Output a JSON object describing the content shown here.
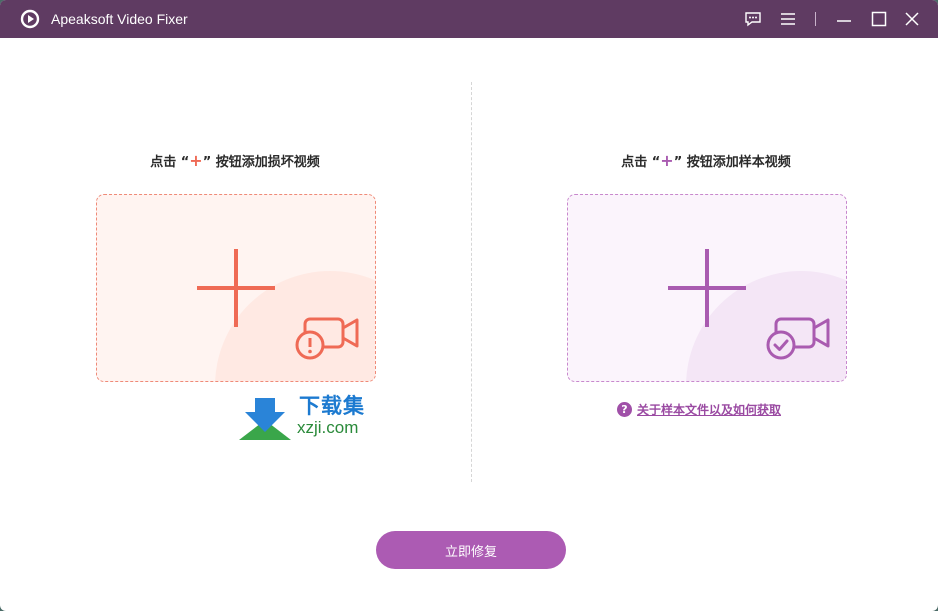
{
  "window": {
    "title": "Apeaksoft Video Fixer",
    "icons": [
      "app-logo-icon",
      "feedback-icon",
      "menu-icon",
      "minimize-icon",
      "maximize-icon",
      "close-icon"
    ]
  },
  "left_panel": {
    "prompt_prefix": "点击 “",
    "prompt_plus": "+",
    "prompt_suffix": "” 按钮添加损坏视频",
    "accent_color": "#ef6a55",
    "icon": "video-camera-warning-icon"
  },
  "right_panel": {
    "prompt_prefix": "点击 “",
    "prompt_plus": "+",
    "prompt_suffix": "” 按钮添加样本视频",
    "accent_color": "#a95bb0",
    "icon": "video-camera-check-icon",
    "help_icon_glyph": "?",
    "help_link": "关于样本文件以及如何获取"
  },
  "watermark": {
    "name": "下载集",
    "url": "xzji.com"
  },
  "repair_button": {
    "label": "立即修复",
    "color": "#ac5bb3"
  }
}
